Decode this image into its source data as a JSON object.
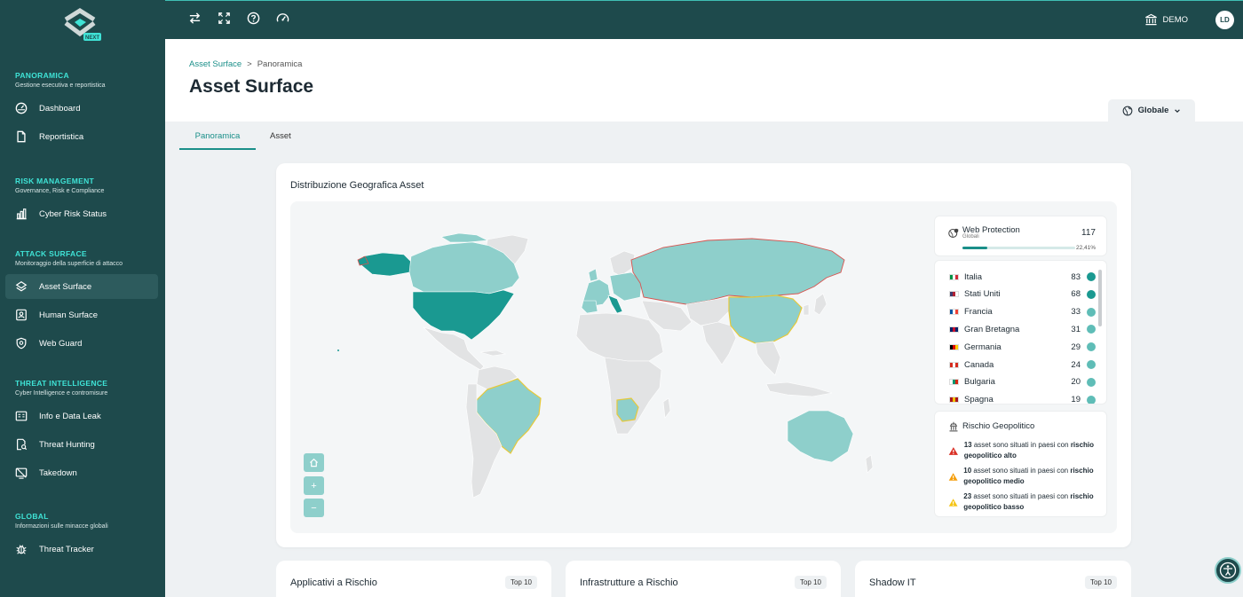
{
  "brand": {
    "badge": "NEXT",
    "accent": "#3fe3d6",
    "primary": "#1e4a4c"
  },
  "sidebar": {
    "sections": [
      {
        "title": "PANORAMICA",
        "subtitle": "Gestione esecutiva e reportistica",
        "items": [
          {
            "label": "Dashboard",
            "icon": "dashboard-icon"
          },
          {
            "label": "Reportistica",
            "icon": "document-icon"
          }
        ]
      },
      {
        "title": "RISK MANAGEMENT",
        "subtitle": "Governance, Risk e Compliance",
        "items": [
          {
            "label": "Cyber Risk Status",
            "icon": "bar-chart-icon"
          }
        ]
      },
      {
        "title": "ATTACK SURFACE",
        "subtitle": "Monitoraggio della superficie di attacco",
        "items": [
          {
            "label": "Asset Surface",
            "icon": "layers-icon",
            "active": true
          },
          {
            "label": "Human Surface",
            "icon": "person-badge-icon"
          },
          {
            "label": "Web Guard",
            "icon": "shield-icon"
          }
        ]
      },
      {
        "title": "THREAT INTELLIGENCE",
        "subtitle": "Cyber Intelligence e contromisure",
        "items": [
          {
            "label": "Info e Data Leak",
            "icon": "database-icon"
          },
          {
            "label": "Threat Hunting",
            "icon": "search-doc-icon"
          },
          {
            "label": "Takedown",
            "icon": "takedown-icon"
          }
        ]
      },
      {
        "title": "GLOBAL",
        "subtitle": "Informazioni sulle minacce globali",
        "items": [
          {
            "label": "Threat Tracker",
            "icon": "bug-icon"
          }
        ]
      }
    ]
  },
  "topbar": {
    "icons": [
      "switch-icon",
      "fullscreen-icon",
      "help-icon",
      "gauge-icon"
    ],
    "org_label": "DEMO",
    "avatar_initials": "LD"
  },
  "header": {
    "breadcrumb": {
      "link": "Asset Surface",
      "separator": ">",
      "current": "Panoramica"
    },
    "title": "Asset Surface",
    "scope": "Globale"
  },
  "tabs": [
    {
      "label": "Panoramica",
      "active": true
    },
    {
      "label": "Asset"
    }
  ],
  "map_card": {
    "title": "Distribuzione Geografica Asset",
    "web_protection": {
      "title": "Web Protection",
      "subtitle": "Globali",
      "count": "117",
      "percent": "22,41%",
      "fraction": 0.2241
    },
    "countries": [
      {
        "name": "Italia",
        "count": "83",
        "flag": [
          "#009246",
          "#ffffff",
          "#ce2b37"
        ],
        "dot": "#1a9991"
      },
      {
        "name": "Stati Uniti",
        "count": "68",
        "flag": [
          "#3c3b6e",
          "#b22234",
          "#ffffff"
        ],
        "dot": "#1a9991"
      },
      {
        "name": "Francia",
        "count": "33",
        "flag": [
          "#0055a4",
          "#ffffff",
          "#ef4135"
        ],
        "dot": "#5fbdb7"
      },
      {
        "name": "Gran Bretagna",
        "count": "31",
        "flag": [
          "#012169",
          "#c8102e",
          "#012169"
        ],
        "dot": "#5fbdb7"
      },
      {
        "name": "Germania",
        "count": "29",
        "flag": [
          "#000000",
          "#dd0000",
          "#ffce00"
        ],
        "dot": "#5fbdb7"
      },
      {
        "name": "Canada",
        "count": "24",
        "flag": [
          "#d52b1e",
          "#ffffff",
          "#d52b1e"
        ],
        "dot": "#5fbdb7"
      },
      {
        "name": "Bulgaria",
        "count": "20",
        "flag": [
          "#ffffff",
          "#00966e",
          "#d62612"
        ],
        "dot": "#5fbdb7"
      },
      {
        "name": "Spagna",
        "count": "19",
        "flag": [
          "#aa151b",
          "#f1bf00",
          "#aa151b"
        ],
        "dot": "#5fbdb7"
      }
    ],
    "geo_risk": {
      "title": "Rischio Geopolitico",
      "items": [
        {
          "count": "13",
          "text": " asset sono situati in paesi con ",
          "bold": "rischio geopolitico alto",
          "color": "#d93025"
        },
        {
          "count": "10",
          "text": " asset sono situati in paesi con ",
          "bold": "rischio geopolitico medio",
          "color": "#f59e0b"
        },
        {
          "count": "23",
          "text": " asset sono situati in paesi con ",
          "bold": "rischio geopolitico basso",
          "color": "#f5c518"
        }
      ]
    },
    "controls": {
      "zoom_in": "+",
      "zoom_out": "−"
    }
  },
  "bottom_cards": [
    {
      "title": "Applicativi a Rischio",
      "badge": "Top 10"
    },
    {
      "title": "Infrastrutture a Rischio",
      "badge": "Top 10"
    },
    {
      "title": "Shadow IT",
      "badge": "Top 10"
    }
  ]
}
